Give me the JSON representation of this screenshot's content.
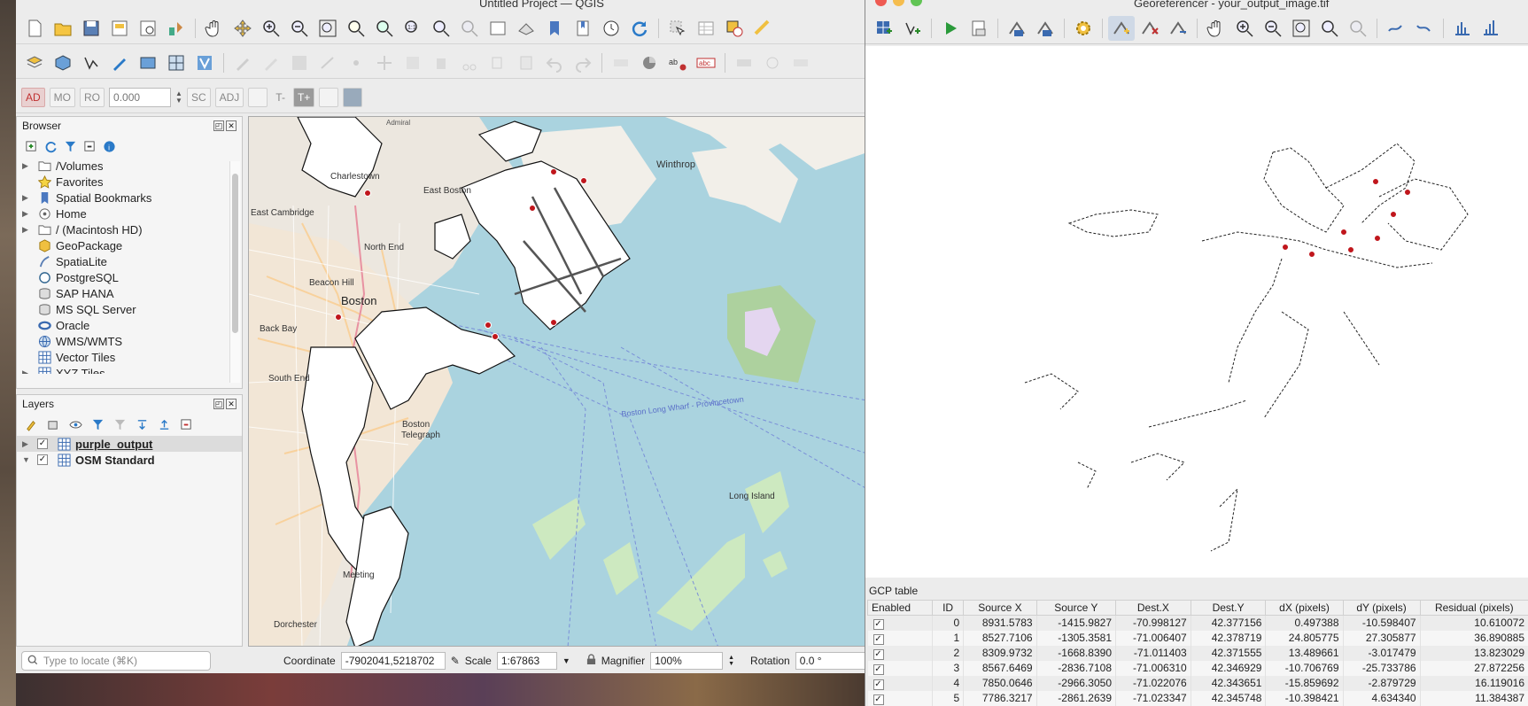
{
  "qgis": {
    "title": "Untitled Project — QGIS",
    "field_value": "0.000",
    "toolbar3_buttons": [
      "AD",
      "MO",
      "RO",
      "SC",
      "ADJ",
      "T-",
      "T+"
    ],
    "browser": {
      "title": "Browser",
      "items": [
        {
          "label": "/Volumes",
          "icon": "folder-icon",
          "expand": true
        },
        {
          "label": "Favorites",
          "icon": "star-icon",
          "expand": false
        },
        {
          "label": "Spatial Bookmarks",
          "icon": "bookmark-icon",
          "expand": true
        },
        {
          "label": "Home",
          "icon": "home-icon",
          "expand": true
        },
        {
          "label": "/ (Macintosh HD)",
          "icon": "folder-icon",
          "expand": true
        },
        {
          "label": "GeoPackage",
          "icon": "geopackage-icon",
          "expand": false
        },
        {
          "label": "SpatiaLite",
          "icon": "spatialite-icon",
          "expand": false
        },
        {
          "label": "PostgreSQL",
          "icon": "postgresql-icon",
          "expand": false
        },
        {
          "label": "SAP HANA",
          "icon": "database-icon",
          "expand": false
        },
        {
          "label": "MS SQL Server",
          "icon": "database-icon",
          "expand": false
        },
        {
          "label": "Oracle",
          "icon": "oracle-icon",
          "expand": false
        },
        {
          "label": "WMS/WMTS",
          "icon": "globe-icon",
          "expand": false
        },
        {
          "label": "Vector Tiles",
          "icon": "grid-icon",
          "expand": false
        },
        {
          "label": "XYZ Tiles",
          "icon": "grid-icon",
          "expand": true
        }
      ]
    },
    "layers": {
      "title": "Layers",
      "items": [
        {
          "label": "purple_output",
          "checked": true,
          "selected": true,
          "underline": true
        },
        {
          "label": "OSM Standard",
          "checked": true,
          "selected": false,
          "underline": false
        }
      ]
    },
    "map_labels": {
      "admiral": "Admiral",
      "charlestown": "Charlestown",
      "east_boston": "East Boston",
      "winthrop": "Winthrop",
      "east_cambridge": "East Cambridge",
      "north_end": "North End",
      "beacon_hill": "Beacon Hill",
      "boston": "Boston",
      "back_bay": "Back Bay",
      "south_end": "South End",
      "boston_south": "Boston",
      "telegraph": "Telegraph",
      "long_island": "Long Island",
      "meeting": "Meeting",
      "dorchester": "Dorchester",
      "long_wharf": "Boston Long Wharf - Provincetown"
    },
    "status": {
      "locator_placeholder": "Type to locate (⌘K)",
      "coordinate_label": "Coordinate",
      "coordinate_value": "-7902041,5218702",
      "scale_label": "Scale",
      "scale_value": "1:67863",
      "magnifier_label": "Magnifier",
      "magnifier_value": "100%",
      "rotation_label": "Rotation",
      "rotation_value": "0.0 °"
    }
  },
  "georef": {
    "title": "Georeferencer - your_output_image.tif",
    "gcp_title": "GCP table",
    "columns": [
      "Enabled",
      "ID",
      "Source X",
      "Source Y",
      "Dest.X",
      "Dest.Y",
      "dX (pixels)",
      "dY (pixels)",
      "Residual (pixels)"
    ],
    "rows": [
      [
        "✓",
        "0",
        "8931.5783",
        "-1415.9827",
        "-70.998127",
        "42.377156",
        "0.497388",
        "-10.598407",
        "10.610072"
      ],
      [
        "✓",
        "1",
        "8527.7106",
        "-1305.3581",
        "-71.006407",
        "42.378719",
        "24.805775",
        "27.305877",
        "36.890885"
      ],
      [
        "✓",
        "2",
        "8309.9732",
        "-1668.8390",
        "-71.011403",
        "42.371555",
        "13.489661",
        "-3.017479",
        "13.823029"
      ],
      [
        "✓",
        "3",
        "8567.6469",
        "-2836.7108",
        "-71.006310",
        "42.346929",
        "-10.706769",
        "-25.733786",
        "27.872256"
      ],
      [
        "✓",
        "4",
        "7850.0646",
        "-2966.3050",
        "-71.022076",
        "42.343651",
        "-15.859692",
        "-2.879729",
        "16.119016"
      ],
      [
        "✓",
        "5",
        "7786.3217",
        "-2861.2639",
        "-71.023347",
        "42.345748",
        "-10.398421",
        "4.634340",
        "11.384387"
      ]
    ]
  },
  "colors": {
    "water": "#aad3df",
    "land": "#f2efe9",
    "gcp_point": "#c0161c",
    "accent": "#1a64c8"
  }
}
